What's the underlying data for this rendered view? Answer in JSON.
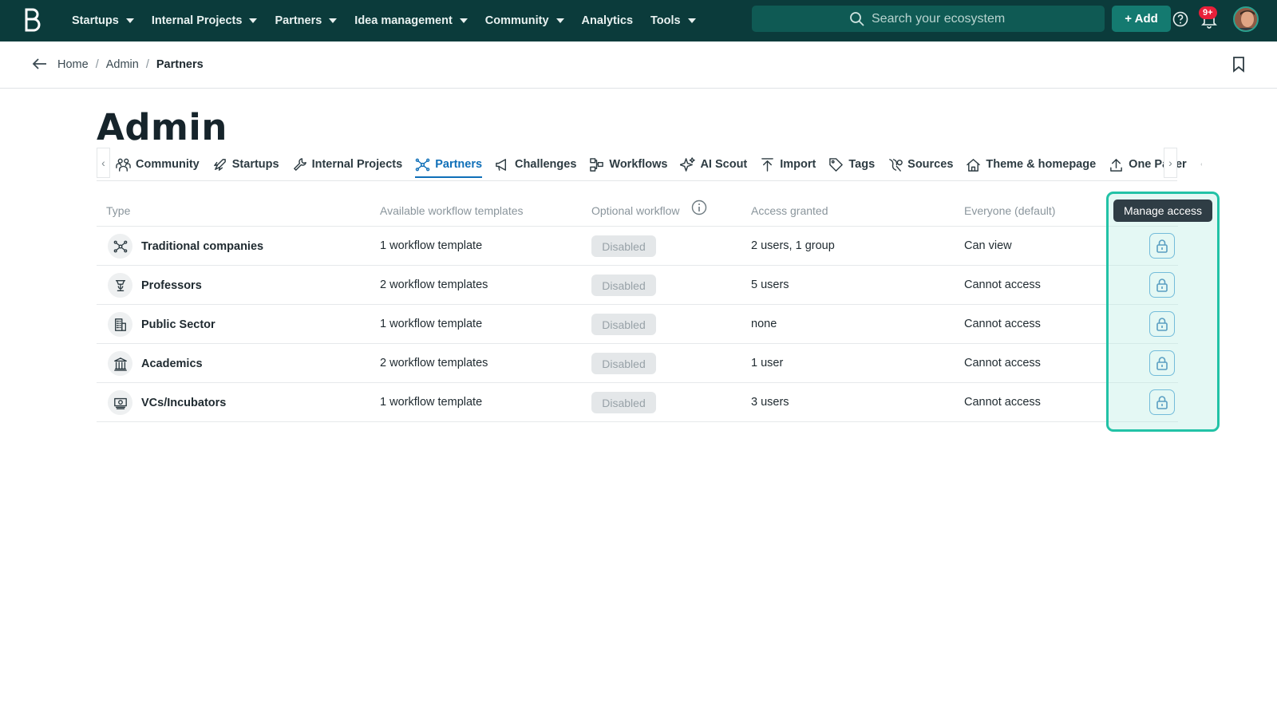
{
  "topbar": {
    "nav": [
      "Startups",
      "Internal Projects",
      "Partners",
      "Idea management",
      "Community",
      "Analytics",
      "Tools"
    ],
    "nav_has_caret": [
      true,
      true,
      true,
      true,
      true,
      false,
      true
    ],
    "search_placeholder": "Search your ecosystem",
    "add_label": "+ Add",
    "notification_badge": "9+"
  },
  "breadcrumb": {
    "home": "Home",
    "sep": "/",
    "admin": "Admin",
    "current": "Partners"
  },
  "page_title": "Admin",
  "tabs": [
    {
      "label": "Community",
      "icon": "people-icon"
    },
    {
      "label": "Startups",
      "icon": "rocket-icon"
    },
    {
      "label": "Internal Projects",
      "icon": "wrench-icon"
    },
    {
      "label": "Partners",
      "icon": "network-icon",
      "active": true
    },
    {
      "label": "Challenges",
      "icon": "megaphone-icon"
    },
    {
      "label": "Workflows",
      "icon": "workflow-icon"
    },
    {
      "label": "AI Scout",
      "icon": "sparkle-icon"
    },
    {
      "label": "Import",
      "icon": "import-icon"
    },
    {
      "label": "Tags",
      "icon": "tag-icon"
    },
    {
      "label": "Sources",
      "icon": "sources-icon"
    },
    {
      "label": "Theme & homepage",
      "icon": "home-icon"
    },
    {
      "label": "One Pager",
      "icon": "upload-icon"
    }
  ],
  "table": {
    "headers": {
      "type": "Type",
      "templates": "Available workflow templates",
      "optional": "Optional workflow",
      "access": "Access granted",
      "everyone": "Everyone (default)"
    },
    "rows": [
      {
        "type": "Traditional companies",
        "icon": "network-icon",
        "templates": "1 workflow template",
        "optional": "Disabled",
        "access": "2 users, 1 group",
        "everyone": "Can view"
      },
      {
        "type": "Professors",
        "icon": "lectern-icon",
        "templates": "2 workflow templates",
        "optional": "Disabled",
        "access": "5 users",
        "everyone": "Cannot access"
      },
      {
        "type": "Public Sector",
        "icon": "building-icon",
        "templates": "1 workflow template",
        "optional": "Disabled",
        "access": "none",
        "everyone": "Cannot access"
      },
      {
        "type": "Academics",
        "icon": "institution-icon",
        "templates": "2 workflow templates",
        "optional": "Disabled",
        "access": "1 user",
        "everyone": "Cannot access"
      },
      {
        "type": "VCs/Incubators",
        "icon": "money-icon",
        "templates": "1 workflow template",
        "optional": "Disabled",
        "access": "3 users",
        "everyone": "Cannot access"
      }
    ]
  },
  "tooltip": "Manage access",
  "colors": {
    "topbar": "#0b3b3b",
    "accent": "#0f6fb8",
    "highlight": "#22c2a6",
    "badge": "#e8203a"
  }
}
